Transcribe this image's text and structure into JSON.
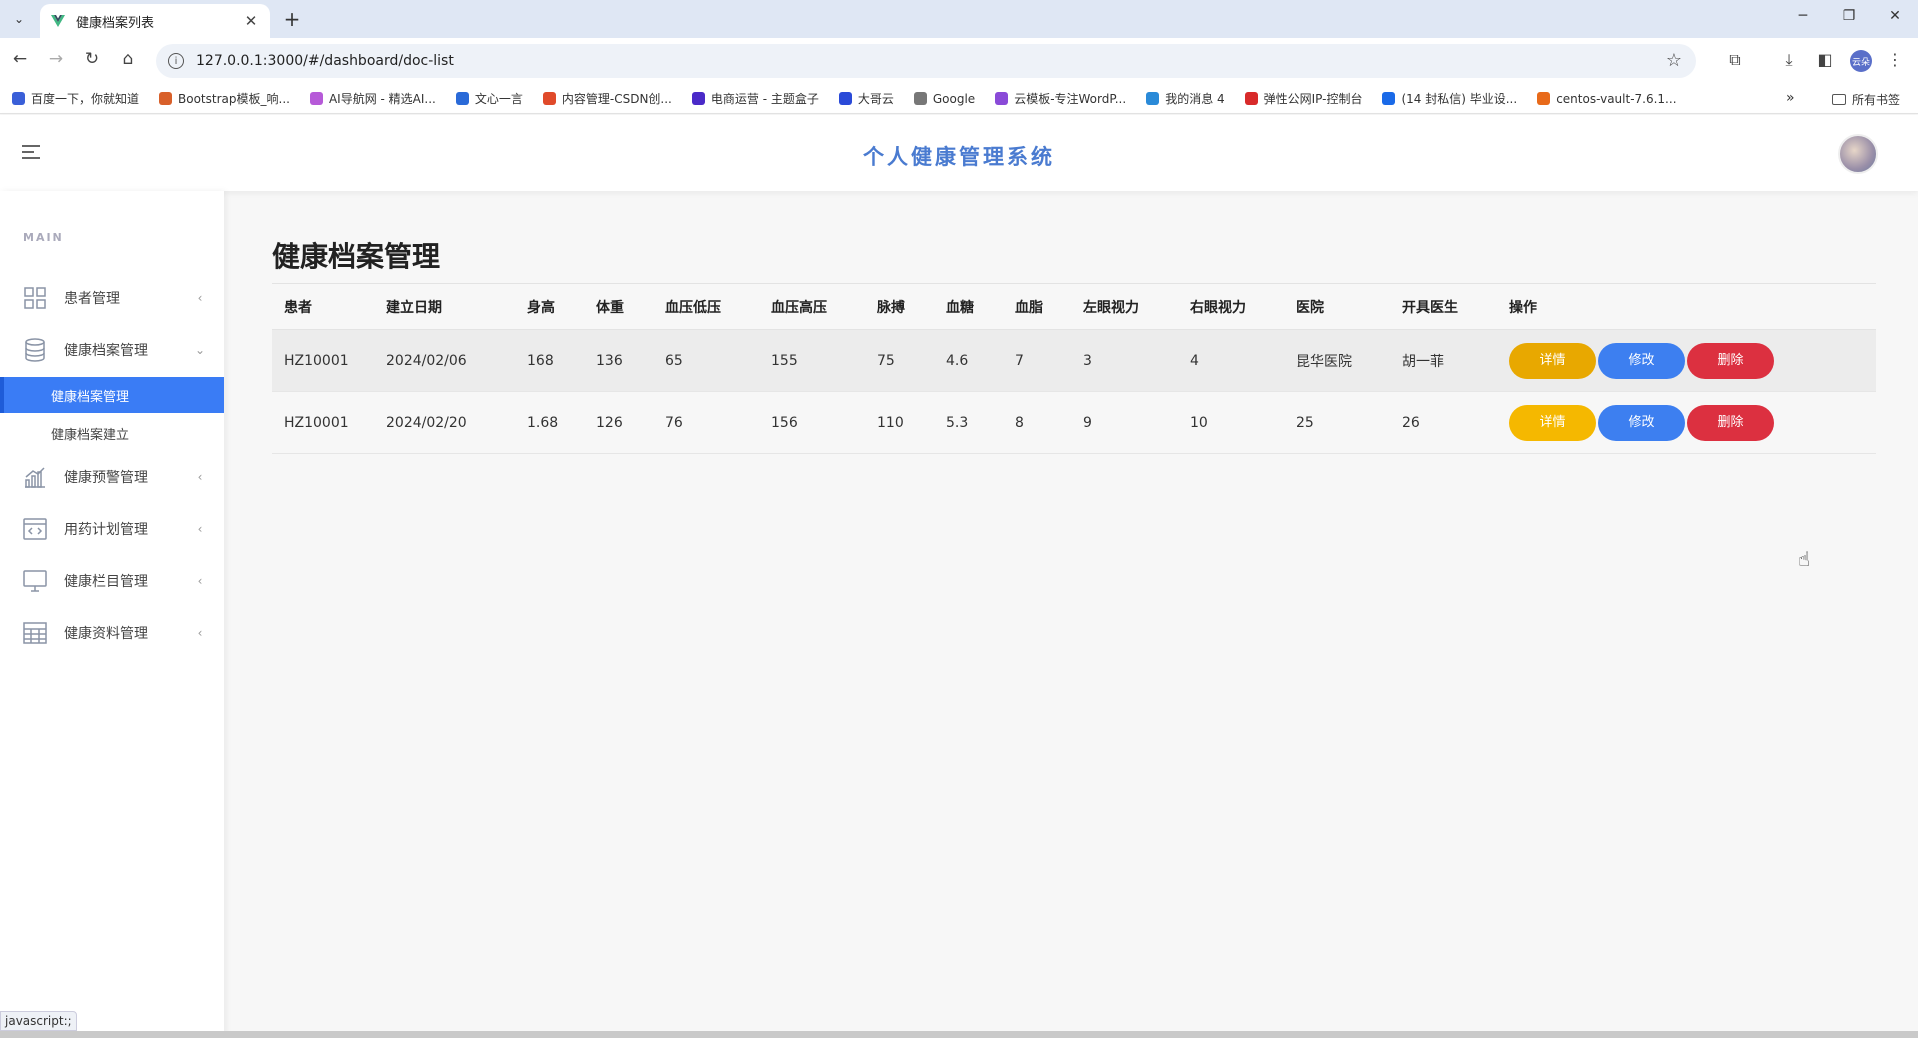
{
  "browser": {
    "tab_title": "健康档案列表",
    "url": "127.0.0.1:3000/#/dashboard/doc-list",
    "profile_initials": "云朵",
    "bookmarks": [
      {
        "label": "百度一下，你就知道",
        "color": "#3a5fd8"
      },
      {
        "label": "Bootstrap模板_响...",
        "color": "#d8602a"
      },
      {
        "label": "AI导航网 - 精选AI...",
        "color": "#b65ad8"
      },
      {
        "label": "文心一言",
        "color": "#2a6ad8"
      },
      {
        "label": "内容管理-CSDN创...",
        "color": "#e04a2a"
      },
      {
        "label": "电商运营 - 主题盒子",
        "color": "#4a2ac8"
      },
      {
        "label": "大哥云",
        "color": "#2a4ad8"
      },
      {
        "label": "Google",
        "color": "#777777"
      },
      {
        "label": "云模板-专注WordP...",
        "color": "#8a4ad8"
      },
      {
        "label": "我的消息 4",
        "color": "#2a8ad8"
      },
      {
        "label": "弹性公网IP-控制台",
        "color": "#d82a2a"
      },
      {
        "label": "(14 封私信) 毕业设...",
        "color": "#1a6ae8"
      },
      {
        "label": "centos-vault-7.6.1...",
        "color": "#e86a1a"
      }
    ],
    "bookmarks_all": "所有书签",
    "status_text": "javascript:;"
  },
  "header": {
    "title": "个人健康管理系统"
  },
  "sidebar": {
    "section": "MAIN",
    "items": [
      {
        "label": "患者管理",
        "icon": "grid-icon"
      },
      {
        "label": "健康档案管理",
        "icon": "database-icon"
      },
      {
        "label": "健康预警管理",
        "icon": "bar-chart-icon"
      },
      {
        "label": "用药计划管理",
        "icon": "code-window-icon"
      },
      {
        "label": "健康栏目管理",
        "icon": "monitor-icon"
      },
      {
        "label": "健康资料管理",
        "icon": "table-icon"
      }
    ],
    "sub_items": [
      {
        "label": "健康档案管理"
      },
      {
        "label": "健康档案建立"
      }
    ]
  },
  "main": {
    "page_title": "健康档案管理",
    "columns": [
      "患者",
      "建立日期",
      "身高",
      "体重",
      "血压低压",
      "血压高压",
      "脉搏",
      "血糖",
      "血脂",
      "左眼视力",
      "右眼视力",
      "医院",
      "开具医生",
      "操作"
    ],
    "rows": [
      [
        "HZ10001",
        "2024/02/06",
        "168",
        "136",
        "65",
        "155",
        "75",
        "4.6",
        "7",
        "3",
        "4",
        "昆华医院",
        "胡一菲"
      ],
      [
        "HZ10001",
        "2024/02/20",
        "1.68",
        "126",
        "76",
        "156",
        "110",
        "5.3",
        "8",
        "9",
        "10",
        "25",
        "26"
      ]
    ],
    "actions": {
      "detail": "详情",
      "edit": "修改",
      "delete": "删除"
    }
  },
  "colors": {
    "accent": "#3a7cf5",
    "detail": "#f5b800",
    "delete": "#dc3040",
    "title": "#4a7bd0"
  }
}
